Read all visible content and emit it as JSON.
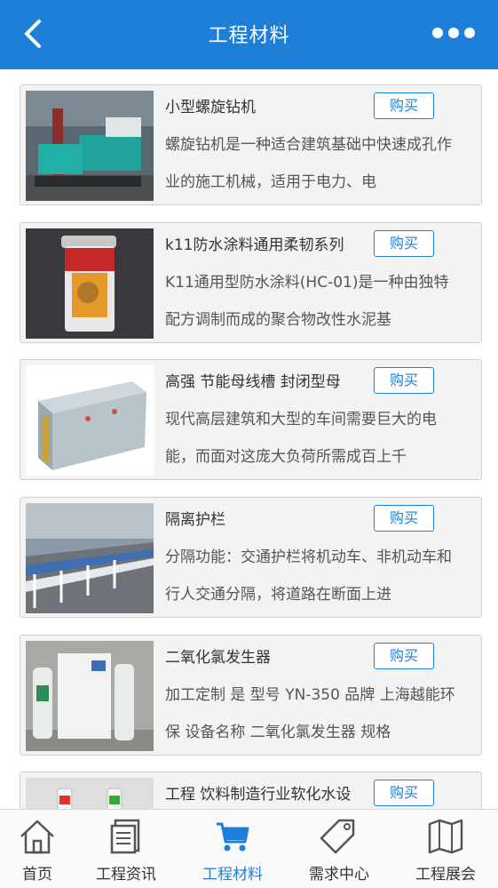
{
  "header": {
    "title": "工程材料",
    "back_icon": "back-arrow-icon",
    "more_icon": "more-dots-icon"
  },
  "products": [
    {
      "name": "小型螺旋钻机",
      "buy_label": "购买",
      "desc": "螺旋钻机是一种适合建筑基础中快速成孔作业的施工机械，适用于电力、电",
      "image": "drilling-machine-photo"
    },
    {
      "name": "k11防水涂料通用柔韧系列",
      "buy_label": "购买",
      "desc": "K11通用型防水涂料(HC-01)是一种由独特配方调制而成的聚合物改性水泥基",
      "image": "paint-bucket-photo"
    },
    {
      "name": "高强 节能母线槽 封闭型母",
      "buy_label": "购买",
      "desc": "现代高层建筑和大型的车间需要巨大的电能，而面对这庞大负荷所需成百上千",
      "image": "busbar-photo"
    },
    {
      "name": "隔离护栏",
      "buy_label": "购买",
      "desc": "分隔功能：交通护栏将机动车、非机动车和行人交通分隔，将道路在断面上进",
      "image": "guardrail-photo"
    },
    {
      "name": "二氧化氯发生器",
      "buy_label": "购买",
      "desc": "加工定制 是 型号 YN-350 品牌 上海越能环保 设备名称 二氧化氯发生器 规格",
      "image": "chlorine-generator-photo"
    },
    {
      "name": "工程 饮料制造行业软化水设",
      "buy_label": "购买",
      "desc": "",
      "image": "water-softener-photo"
    }
  ],
  "tabbar": {
    "items": [
      {
        "label": "首页",
        "icon": "home-icon",
        "active": false
      },
      {
        "label": "工程资讯",
        "icon": "news-icon",
        "active": false
      },
      {
        "label": "工程材料",
        "icon": "cart-icon",
        "active": true
      },
      {
        "label": "需求中心",
        "icon": "tag-icon",
        "active": false
      },
      {
        "label": "工程展会",
        "icon": "map-icon",
        "active": false
      }
    ]
  },
  "colors": {
    "brand": "#1e7fd9",
    "card_bg": "#f3f3f3",
    "text": "#333333"
  }
}
